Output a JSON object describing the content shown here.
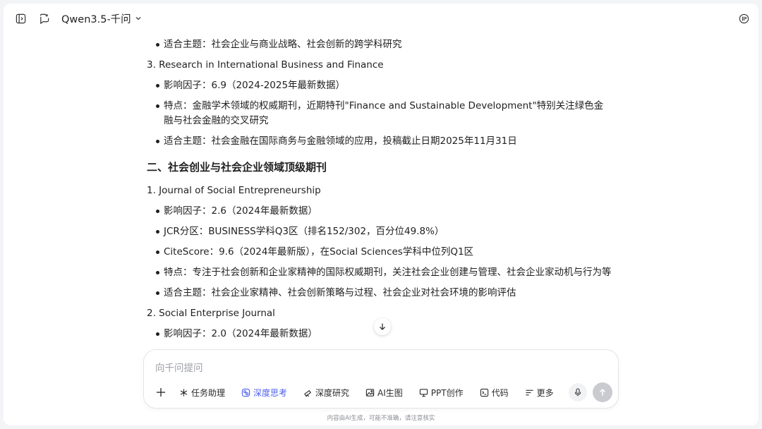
{
  "topbar": {
    "model_name": "Qwen3.5-千问",
    "icons": [
      "sidebar-toggle-icon",
      "new-chat-icon",
      "chevron-down-icon",
      "user-icon"
    ]
  },
  "content": [
    {
      "kind": "bullet",
      "text": "适合主题：社会企业与商业战略、社会创新的跨学科研究"
    },
    {
      "kind": "num",
      "text": "3. Research in International Business and Finance"
    },
    {
      "kind": "bullet",
      "text": "影响因子：6.9（2024-2025年最新数据）"
    },
    {
      "kind": "bullet",
      "text": "特点：金融学术领域的权威期刊，近期特刊\"Finance and Sustainable Development\"特别关注绿色金融与社会金融的交叉研究"
    },
    {
      "kind": "bullet",
      "text": "适合主题：社会金融在国际商务与金融领域的应用，投稿截止日期2025年11月31日"
    },
    {
      "kind": "heading",
      "text": "二、社会创业与社会企业领域顶级期刊"
    },
    {
      "kind": "num",
      "text": "1. Journal of Social Entrepreneurship"
    },
    {
      "kind": "bullet",
      "text": "影响因子：2.6（2024年最新数据）"
    },
    {
      "kind": "bullet",
      "text": "JCR分区：BUSINESS学科Q3区（排名152/302，百分位49.8%）"
    },
    {
      "kind": "bullet",
      "text": "CiteScore：9.6（2024年最新版），在Social Sciences学科中位列Q1区"
    },
    {
      "kind": "bullet",
      "text": "特点：专注于社会创新和企业家精神的国际权威期刊，关注社会企业创建与管理、社会企业家动机与行为等"
    },
    {
      "kind": "bullet",
      "text": "适合主题：社会企业家精神、社会创新策略与过程、社会企业对社会环境的影响评估"
    },
    {
      "kind": "num",
      "text": "2. Social Enterprise Journal"
    },
    {
      "kind": "bullet",
      "text": "影响因子：2.0（2024年最新数据）"
    }
  ],
  "composer": {
    "placeholder": "向千问提问",
    "tools": [
      {
        "label": "任务助理",
        "icon": "asterisk-icon",
        "name": "task-assistant",
        "active": false
      },
      {
        "label": "深度思考",
        "icon": "deep-think-icon",
        "name": "deep-think",
        "active": true
      },
      {
        "label": "深度研究",
        "icon": "telescope-icon",
        "name": "deep-research",
        "active": false
      },
      {
        "label": "AI生图",
        "icon": "image-icon",
        "name": "ai-image",
        "active": false
      },
      {
        "label": "PPT创作",
        "icon": "presentation-icon",
        "name": "ppt-create",
        "active": false
      },
      {
        "label": "代码",
        "icon": "terminal-icon",
        "name": "code",
        "active": false
      },
      {
        "label": "更多",
        "icon": "menu-lines-icon",
        "name": "more",
        "active": false
      }
    ]
  },
  "footer": {
    "disclaimer": "内容由AI生成，可能不准确，请注意核实"
  },
  "colors": {
    "accent": "#4c5ef0",
    "send_disabled": "#c9cbd1"
  }
}
